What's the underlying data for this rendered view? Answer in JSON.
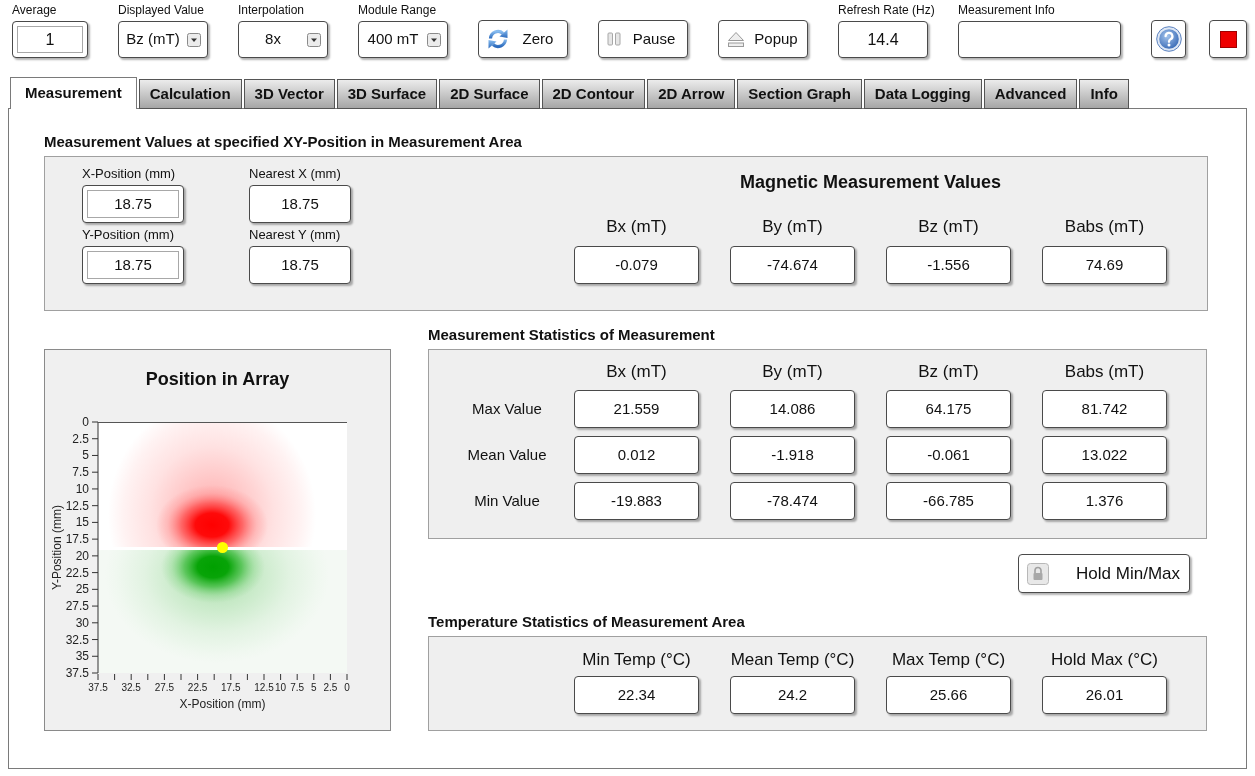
{
  "toolbar": {
    "controls": [
      {
        "kind": "numeric",
        "label": "Average",
        "value": "1"
      },
      {
        "kind": "dropdown",
        "label": "Displayed Value",
        "value": "Bz (mT)"
      },
      {
        "kind": "dropdown",
        "label": "Interpolation",
        "value": "8x"
      },
      {
        "kind": "dropdown",
        "label": "Module Range",
        "value": "400 mT"
      },
      {
        "kind": "zero",
        "label": "Zero"
      },
      {
        "kind": "pause",
        "label": "Pause"
      },
      {
        "kind": "popup",
        "label": "Popup"
      },
      {
        "kind": "indicator",
        "label": "Refresh Rate (Hz)",
        "value": "14.4"
      },
      {
        "kind": "textbox",
        "label": "Measurement Info"
      },
      {
        "kind": "help"
      },
      {
        "kind": "stop"
      }
    ]
  },
  "tabs": [
    {
      "label": "Measurement",
      "selected": true
    },
    {
      "label": "Calculation",
      "selected": false
    },
    {
      "label": "3D Vector",
      "selected": false
    },
    {
      "label": "3D Surface",
      "selected": false
    },
    {
      "label": "2D Surface",
      "selected": false
    },
    {
      "label": "2D Contour",
      "selected": false
    },
    {
      "label": "2D Arrow",
      "selected": false
    },
    {
      "label": "Section Graph",
      "selected": false
    },
    {
      "label": "Data Logging",
      "selected": false
    },
    {
      "label": "Advanced",
      "selected": false
    },
    {
      "label": "Info",
      "selected": false
    }
  ],
  "measurement_values": {
    "title": "Measurement Values at specified XY-Position in Measurement Area",
    "position_fields": [
      {
        "kind": "control",
        "label": "X-Position (mm)",
        "value": "18.75"
      },
      {
        "kind": "indicator",
        "label": "Nearest X (mm)",
        "value": "18.75"
      },
      {
        "kind": "control",
        "label": "Y-Position (mm)",
        "value": "18.75"
      },
      {
        "kind": "indicator",
        "label": "Nearest Y (mm)",
        "value": "18.75"
      }
    ],
    "magnetic": {
      "title": "Magnetic Measurement Values",
      "columns": [
        "Bx (mT)",
        "By (mT)",
        "Bz (mT)",
        "Babs (mT)"
      ],
      "values": [
        "-0.079",
        "-74.674",
        "-1.556",
        "74.69"
      ]
    }
  },
  "position_in_array": {
    "chart_data": {
      "type": "scatter",
      "title": "Position in Array",
      "xlabel": "X-Position (mm)",
      "ylabel": "Y-Position (mm)",
      "x": [
        18.75
      ],
      "series": [
        {
          "color": "#ffff00",
          "values": [
            18.75
          ]
        }
      ],
      "xlim": [
        37.5,
        0
      ],
      "ylim": [
        37.5,
        0
      ],
      "xticks": [
        37.5,
        32.5,
        27.5,
        22.5,
        17.5,
        12.5,
        10,
        7.5,
        5,
        2.5,
        0
      ],
      "yticks": [
        0,
        2.5,
        5,
        7.5,
        10,
        12.5,
        15,
        17.5,
        20,
        22.5,
        25,
        27.5,
        30,
        32.5,
        35,
        37.5
      ]
    }
  },
  "statistics": {
    "title": "Measurement Statistics of Measurement",
    "columns": [
      "Bx (mT)",
      "By (mT)",
      "Bz (mT)",
      "Babs (mT)"
    ],
    "rows": [
      {
        "label": "Max Value",
        "values": [
          "21.559",
          "14.086",
          "64.175",
          "81.742"
        ]
      },
      {
        "label": "Mean Value",
        "values": [
          "0.012",
          "-1.918",
          "-0.061",
          "13.022"
        ]
      },
      {
        "label": "Min Value",
        "values": [
          "-19.883",
          "-78.474",
          "-66.785",
          "1.376"
        ]
      }
    ]
  },
  "hold_button": {
    "label": "Hold Min/Max"
  },
  "temperature": {
    "title": "Temperature Statistics of Measurement Area",
    "columns": [
      "Min Temp (°C)",
      "Mean Temp (°C)",
      "Max Temp (°C)",
      "Hold Max (°C)"
    ],
    "values": [
      "22.34",
      "24.2",
      "25.66",
      "26.01"
    ]
  }
}
